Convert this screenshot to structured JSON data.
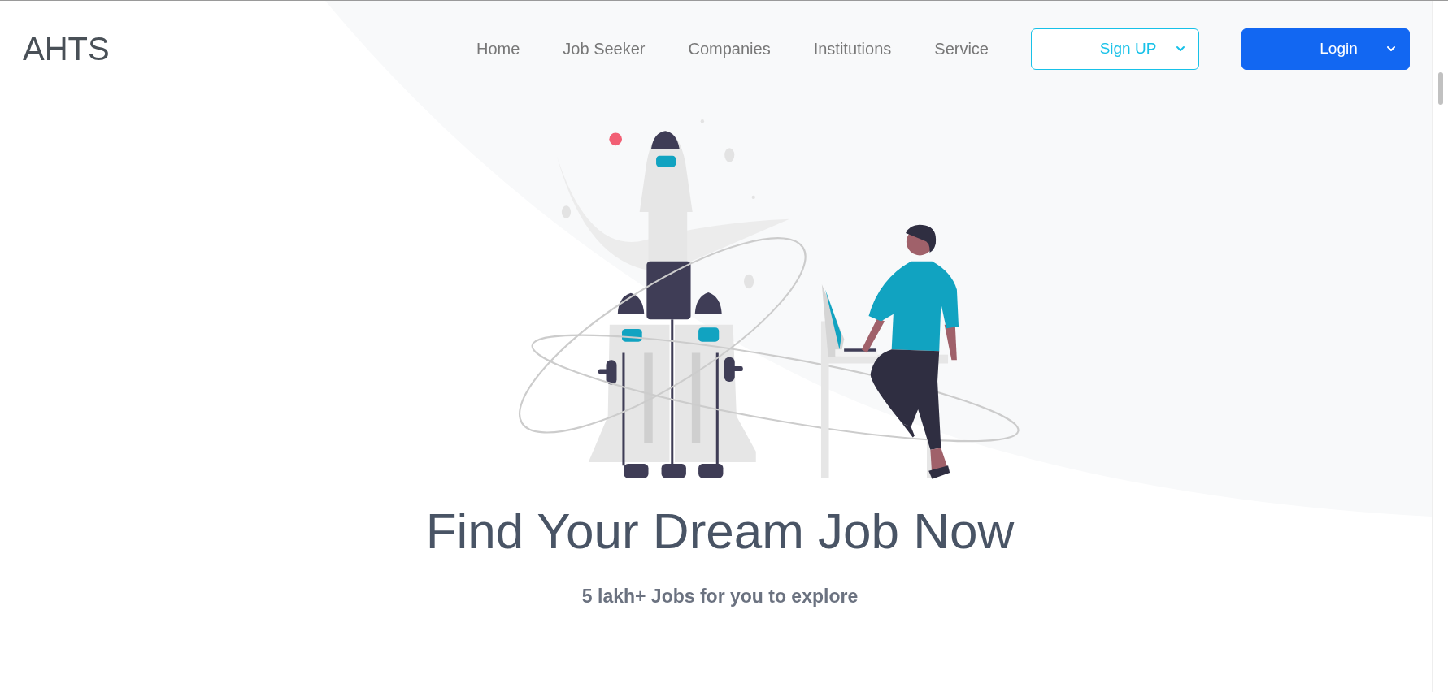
{
  "logo": "AHTS",
  "nav": [
    {
      "label": "Home"
    },
    {
      "label": "Job Seeker"
    },
    {
      "label": "Companies"
    },
    {
      "label": "Institutions"
    },
    {
      "label": "Service"
    }
  ],
  "buttons": [
    {
      "label": "Sign UP",
      "kind": "outline"
    },
    {
      "label": "Login",
      "kind": "solid"
    }
  ],
  "hero": {
    "title": "Find Your Dream Job Now",
    "subtitle": "5 lakh+ Jobs for you to explore"
  }
}
